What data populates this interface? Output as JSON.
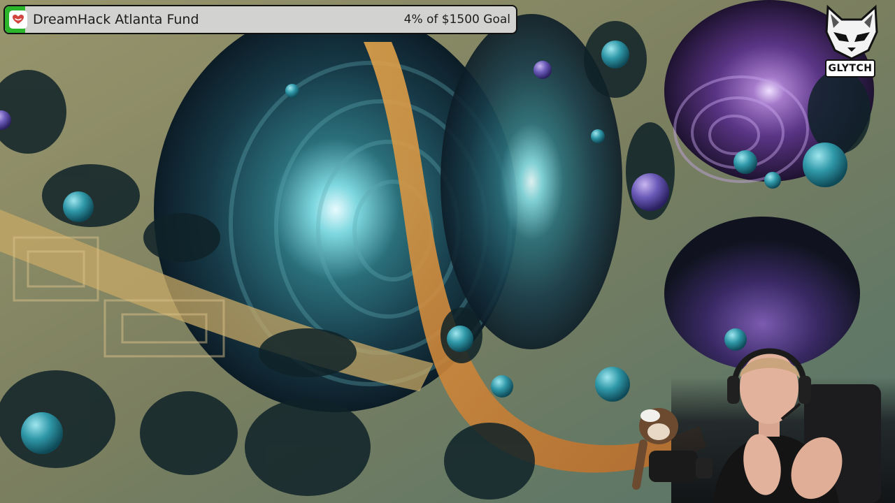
{
  "goal_widget": {
    "icon": "heart-icon",
    "title": "DreamHack Atlanta Fund",
    "amount_text": "4% of $1500 Goal",
    "progress_fraction": 0.04,
    "progress_color": "#2bb52b"
  },
  "channel_logo": {
    "icon": "fox-head-icon",
    "label": "GLYTCH"
  },
  "scene": {
    "background_art": "surreal-organic-tunnel-artwork",
    "webcam": "streamer-webcam-overlay"
  }
}
